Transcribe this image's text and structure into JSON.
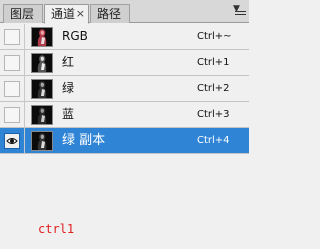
{
  "tabs": [
    {
      "label": "图层"
    },
    {
      "label": "通道",
      "close": "×"
    },
    {
      "label": "路径"
    }
  ],
  "panel_menu": {
    "icon": "panel-menu-icon",
    "glyph": "▼"
  },
  "channels": [
    {
      "name": "RGB",
      "shortcut": "Ctrl+~",
      "visible": false,
      "selected": false
    },
    {
      "name": "红",
      "shortcut": "Ctrl+1",
      "visible": false,
      "selected": false
    },
    {
      "name": "绿",
      "shortcut": "Ctrl+2",
      "visible": false,
      "selected": false
    },
    {
      "name": "蓝",
      "shortcut": "Ctrl+3",
      "visible": false,
      "selected": false
    },
    {
      "name": "绿 副本",
      "shortcut": "Ctrl+4",
      "visible": true,
      "selected": true
    }
  ],
  "annotation": {
    "text": "ctrl1",
    "color": "#e02020"
  },
  "colors": {
    "selected_row": "#2f84d6",
    "panel_bg": "#f0f0f0"
  }
}
